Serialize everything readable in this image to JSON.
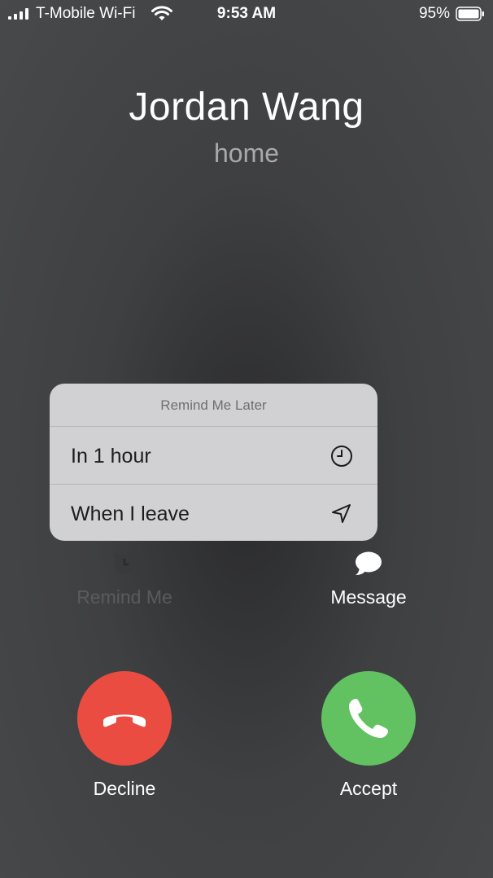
{
  "status_bar": {
    "carrier": "T-Mobile Wi-Fi",
    "time": "9:53 AM",
    "battery_percent": "95%",
    "icons": [
      "signal-icon",
      "wifi-icon",
      "battery-icon"
    ]
  },
  "caller": {
    "name": "Jordan Wang",
    "label": "home"
  },
  "remind_popup": {
    "header": "Remind Me Later",
    "items": [
      {
        "label": "In 1 hour",
        "icon": "clock-icon"
      },
      {
        "label": "When I leave",
        "icon": "location-arrow-icon"
      }
    ]
  },
  "actions": {
    "remind_me": {
      "label": "Remind Me",
      "icon": "alarm-icon"
    },
    "message": {
      "label": "Message",
      "icon": "speech-bubble-icon"
    }
  },
  "call_buttons": {
    "decline": {
      "label": "Decline",
      "color": "#eb4c41",
      "icon": "phone-hangup-icon"
    },
    "accept": {
      "label": "Accept",
      "color": "#62c161",
      "icon": "phone-icon"
    }
  }
}
